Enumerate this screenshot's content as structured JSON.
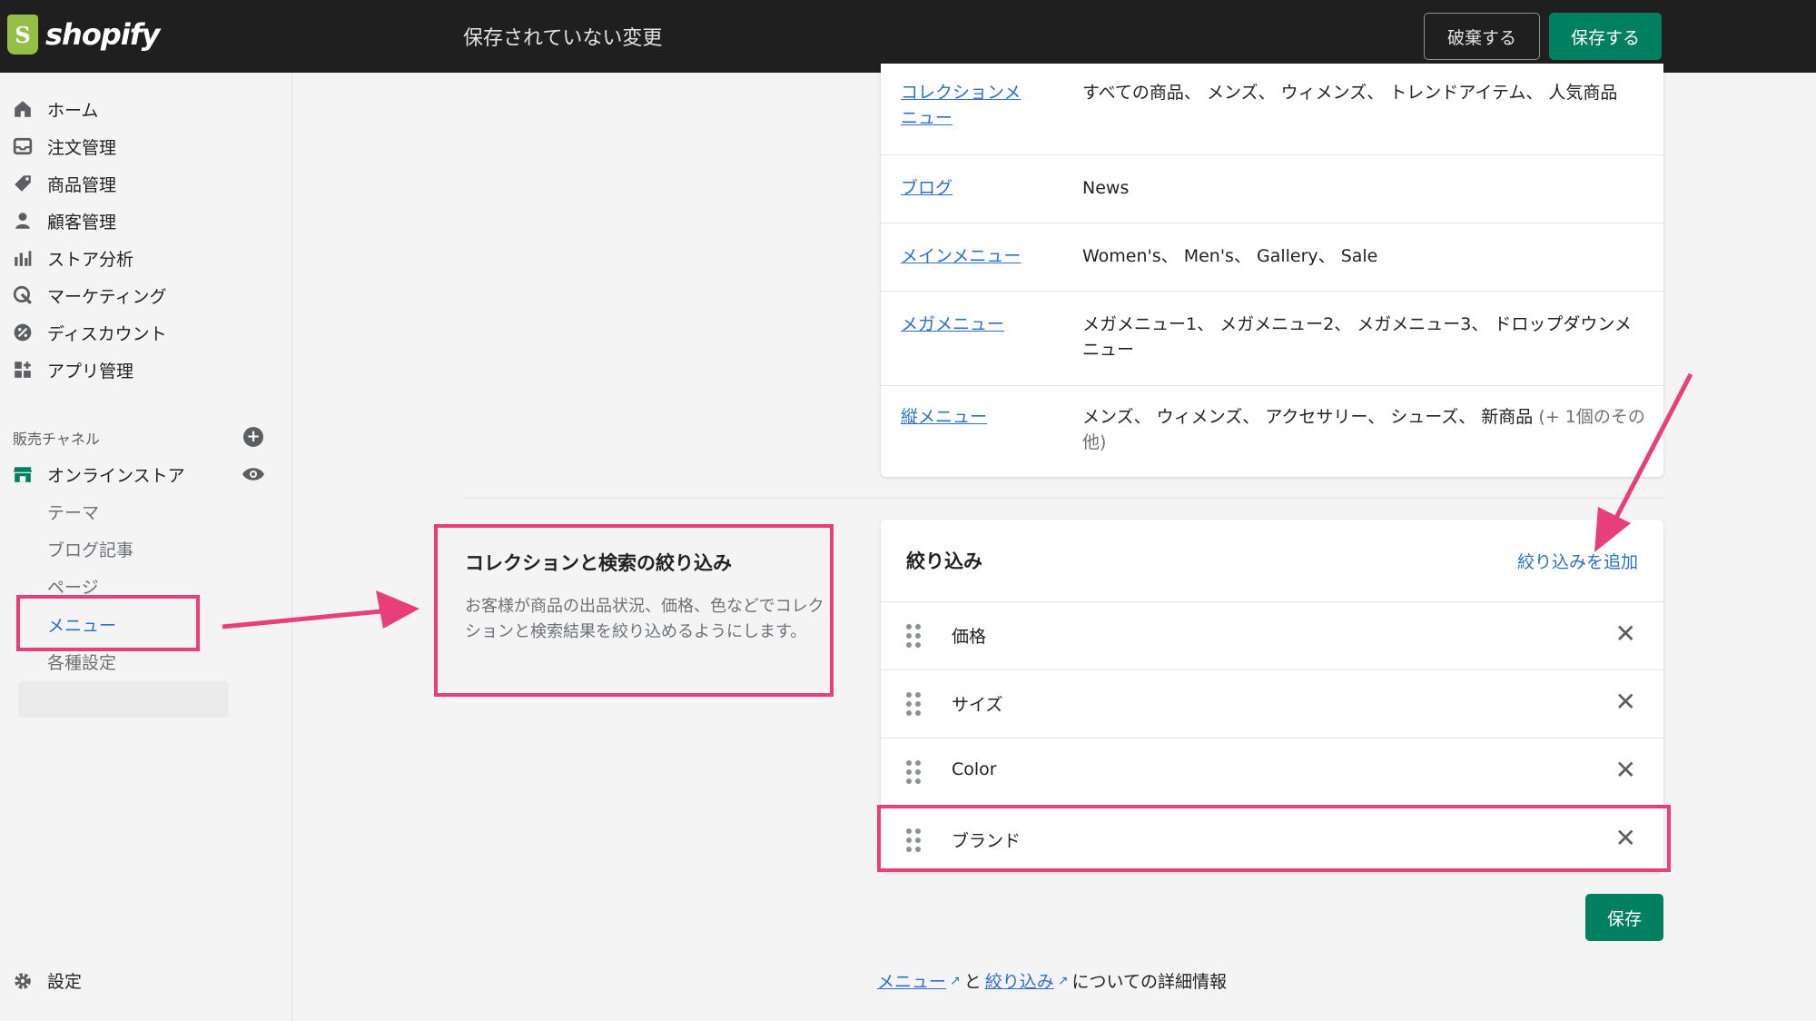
{
  "topbar": {
    "logo_text": "shopify",
    "title": "保存されていない変更",
    "discard_label": "破棄する",
    "save_label": "保存する"
  },
  "sidebar": {
    "items": [
      {
        "label": "ホーム",
        "icon": "home-icon"
      },
      {
        "label": "注文管理",
        "icon": "orders-icon"
      },
      {
        "label": "商品管理",
        "icon": "tag-icon"
      },
      {
        "label": "顧客管理",
        "icon": "customer-icon"
      },
      {
        "label": "ストア分析",
        "icon": "analytics-icon"
      },
      {
        "label": "マーケティング",
        "icon": "marketing-icon"
      },
      {
        "label": "ディスカウント",
        "icon": "discount-icon"
      },
      {
        "label": "アプリ管理",
        "icon": "apps-icon"
      }
    ],
    "channel_label": "販売チャネル",
    "online_store": "オンラインストア",
    "sub_items": [
      "テーマ",
      "ブログ記事",
      "ページ",
      "メニュー",
      "各種設定"
    ],
    "settings": "設定"
  },
  "menus": [
    {
      "name": "コレクションメニュー",
      "items": "すべての商品、 メンズ、 ウィメンズ、 トレンドアイテム、 人気商品"
    },
    {
      "name": "ブログ",
      "items": "News"
    },
    {
      "name": "メインメニュー",
      "items": "Women's、 Men's、 Gallery、 Sale"
    },
    {
      "name": "メガメニュー",
      "items": "メガメニュー1、 メガメニュー2、 メガメニュー3、 ドロップダウンメニュー"
    },
    {
      "name": "縦メニュー",
      "items": "メンズ、 ウィメンズ、 アクセサリー、 シューズ、 新商品",
      "extra": "(+ 1個のその他)"
    }
  ],
  "filter_section": {
    "title": "コレクションと検索の絞り込み",
    "description": "お客様が商品の出品状況、価格、色などでコレクションと検索結果を絞り込めるようにします。",
    "card_title": "絞り込み",
    "add_label": "絞り込みを追加",
    "filters": [
      "価格",
      "サイズ",
      "Color",
      "ブランド"
    ],
    "save_label": "保存"
  },
  "footer": {
    "link_menu": "メニュー",
    "connector": "と",
    "link_filter": "絞り込み",
    "suffix": "についての詳細情報"
  },
  "colors": {
    "accent": "#008060",
    "link": "#2c6ecb",
    "annotation": "#e83e7a"
  }
}
